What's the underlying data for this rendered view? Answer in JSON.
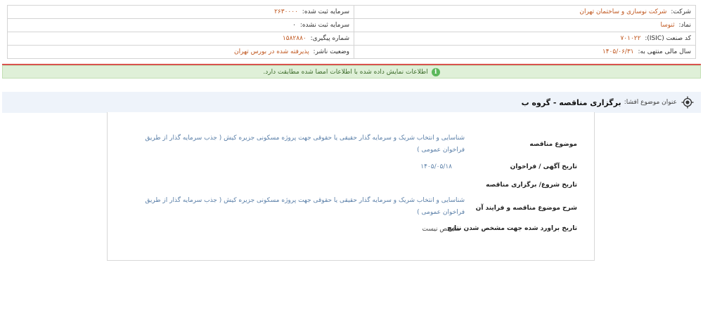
{
  "company_info": {
    "company_label": "شرکت:",
    "company_value": "شرکت نوسازی و ساختمان تهران",
    "registered_capital_label": "سرمایه ثبت شده:",
    "registered_capital_value": "۲۶۳۰۰۰۰",
    "symbol_label": "نماد:",
    "symbol_value": "ثنوسا",
    "unregistered_capital_label": "سرمایه ثبت نشده:",
    "unregistered_capital_value": "۰",
    "isic_label": "کد صنعت (ISIC):",
    "isic_value": "۷۰۱۰۲۲",
    "tracking_label": "شماره پیگیری:",
    "tracking_value": "۱۵۸۲۸۸۰",
    "fiscal_year_label": "سال مالی منتهی به:",
    "fiscal_year_value": "۱۴۰۵/۰۶/۳۱",
    "publisher_status_label": "وضعیت ناشر:",
    "publisher_status_value": "پذیرفته شده در بورس تهران"
  },
  "notice": {
    "text": "اطلاعات نمایش داده شده با اطلاعات امضا شده مطابقت دارد."
  },
  "subject": {
    "label": "عنوان موضوع افشا:",
    "title": "برگزاری مناقصه - گروه ب"
  },
  "details": {
    "tender_subject_label": "موضوع مناقصه",
    "tender_subject_value": "شناسایی و انتخاب شریک و سرمایه گذار حقیقی یا حقوقی جهت پروژه مسکونی جزیره کیش ( جذب سرمایه گذار از طریق فراخوان عمومی )",
    "ad_date_label": "تاریخ آگهی / فراخوان",
    "ad_date_value": "۱۴۰۵/۰۵/۱۸",
    "start_date_label": "تاریخ شروع/ برگزاری مناقصه",
    "start_date_value": "",
    "description_label": "شرح موضوع مناقصه و فرایند آن",
    "description_value": "شناسایی و انتخاب شریک و سرمایه گذار حقیقی یا حقوقی جهت پروژه مسکونی جزیره کیش ( جذب سرمایه گذار از طریق فراخوان عمومی )",
    "estimated_date_label": "تاریخ براورد شده جهت مشخص شدن نتایج",
    "estimated_date_value": "مشخص نیست"
  }
}
